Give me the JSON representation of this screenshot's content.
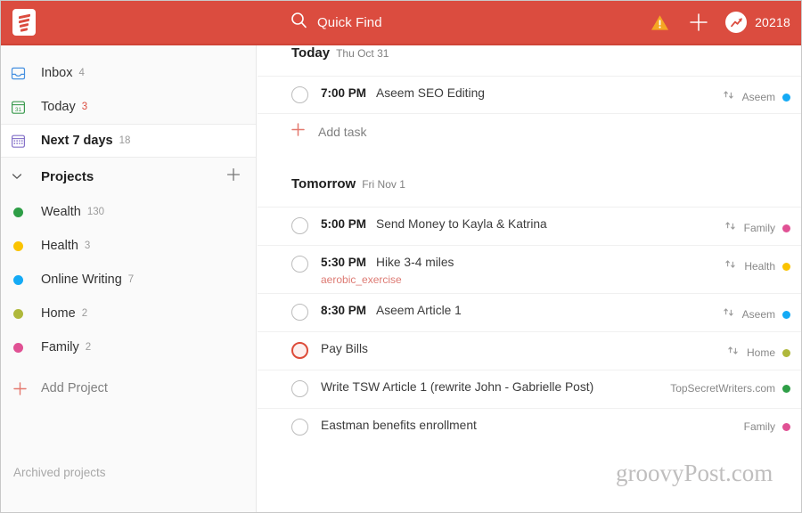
{
  "header": {
    "logo_icon": "todoist-logo-icon",
    "search": {
      "icon": "search-icon",
      "label": "Quick Find"
    },
    "warning_icon": "warning-triangle-icon",
    "add_icon": "plus-icon",
    "karma_icon": "karma-trend-icon",
    "karma_count": "20218",
    "bg_color": "#db4c3f"
  },
  "sidebar": {
    "nav": [
      {
        "icon": "inbox-icon",
        "label": "Inbox",
        "count": "4",
        "active": false,
        "count_color": "#999999"
      },
      {
        "icon": "calendar-today-icon",
        "label": "Today",
        "count": "3",
        "active": false,
        "count_color": "#db4c3f"
      },
      {
        "icon": "calendar-week-icon",
        "label": "Next 7 days",
        "count": "18",
        "active": true,
        "count_color": "#999999"
      }
    ],
    "projects_header": {
      "label": "Projects",
      "chevron_icon": "chevron-down-icon",
      "add_icon": "plus-icon"
    },
    "projects": [
      {
        "label": "Wealth",
        "count": "130",
        "color": "#2e9e46"
      },
      {
        "label": "Health",
        "count": "3",
        "color": "#fac300"
      },
      {
        "label": "Online Writing",
        "count": "7",
        "color": "#14aaf5"
      },
      {
        "label": "Home",
        "count": "2",
        "color": "#afb83b"
      },
      {
        "label": "Family",
        "count": "2",
        "color": "#e05194"
      }
    ],
    "add_project": {
      "label": "Add Project",
      "icon": "plus-icon"
    },
    "archived": "Archived projects"
  },
  "main": {
    "sections": [
      {
        "title": "Today",
        "date": "Thu Oct 31",
        "tasks": [
          {
            "time": "7:00 PM",
            "title": "Aseem SEO Editing",
            "label": "",
            "recurring": true,
            "project": "Aseem",
            "project_color": "#14aaf5",
            "priority": "normal"
          }
        ],
        "add_task": {
          "label": "Add task",
          "icon": "plus-icon"
        }
      },
      {
        "title": "Tomorrow",
        "date": "Fri Nov 1",
        "tasks": [
          {
            "time": "5:00 PM",
            "title": "Send Money to Kayla & Katrina",
            "label": "",
            "recurring": true,
            "project": "Family",
            "project_color": "#e05194",
            "priority": "normal"
          },
          {
            "time": "5:30 PM",
            "title": "Hike 3-4 miles",
            "label": "aerobic_exercise",
            "recurring": true,
            "project": "Health",
            "project_color": "#fac300",
            "priority": "normal"
          },
          {
            "time": "8:30 PM",
            "title": "Aseem Article 1",
            "label": "",
            "recurring": true,
            "project": "Aseem",
            "project_color": "#14aaf5",
            "priority": "normal"
          },
          {
            "time": "",
            "title": "Pay Bills",
            "label": "",
            "recurring": true,
            "project": "Home",
            "project_color": "#afb83b",
            "priority": "p1"
          },
          {
            "time": "",
            "title": "Write TSW Article 1 (rewrite John - Gabrielle Post)",
            "label": "",
            "recurring": false,
            "project": "TopSecretWriters.com",
            "project_color": "#2e9e46",
            "priority": "normal"
          },
          {
            "time": "",
            "title": "Eastman benefits enrollment",
            "label": "",
            "recurring": false,
            "project": "Family",
            "project_color": "#e05194",
            "priority": "normal"
          }
        ],
        "add_task": null
      }
    ]
  },
  "watermark": "groovyPost.com"
}
